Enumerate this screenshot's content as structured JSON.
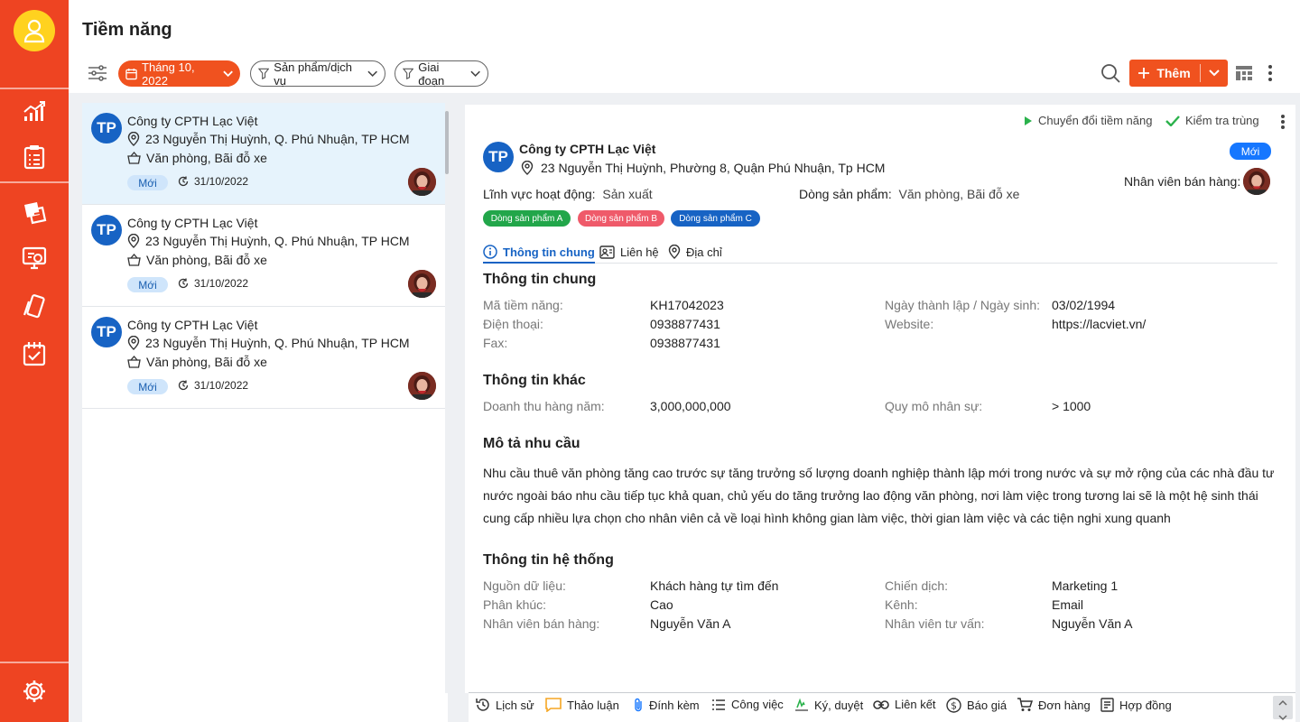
{
  "app": {
    "title": "Tiềm năng"
  },
  "colors": {
    "brand": "#ee4422",
    "accent": "#f0521f",
    "primary_blue": "#1763c4",
    "status_blue": "#1677ff"
  },
  "sidebar": {
    "logo_icon": "user-icon",
    "items": [
      {
        "icon": "chart-icon"
      },
      {
        "icon": "clipboard-icon"
      },
      {
        "icon": "ticket-icon"
      },
      {
        "icon": "monitor-icon"
      },
      {
        "icon": "cards-icon"
      },
      {
        "icon": "task-board-icon"
      }
    ],
    "settings_icon": "gear-icon"
  },
  "toolbar": {
    "filter_icon": "sliders-icon",
    "date_filter": "Tháng 10, 2022",
    "product_filter": "Sản phẩm/dịch vụ",
    "stage_filter": "Giai đoạn",
    "add_label": "Thêm"
  },
  "list": {
    "items": [
      {
        "initials": "TP",
        "name": "Công ty CPTH Lạc Việt",
        "address": "23 Nguyễn Thị Huỳnh, Q. Phú Nhuận, TP HCM",
        "products": "Văn phòng, Bãi đỗ xe",
        "status": "Mới",
        "date": "31/10/2022",
        "active": true
      },
      {
        "initials": "TP",
        "name": "Công ty CPTH Lạc Việt",
        "address": "23 Nguyễn Thị Huỳnh, Q. Phú Nhuận, TP HCM",
        "products": "Văn phòng, Bãi đỗ xe",
        "status": "Mới",
        "date": "31/10/2022",
        "active": false
      },
      {
        "initials": "TP",
        "name": "Công ty CPTH Lạc Việt",
        "address": "23 Nguyễn Thị Huỳnh, Q. Phú Nhuận, TP HCM",
        "products": "Văn phòng, Bãi đỗ xe",
        "status": "Mới",
        "date": "31/10/2022",
        "active": false
      }
    ]
  },
  "detail": {
    "actions": {
      "convert": "Chuyển đổi tiềm năng",
      "check": "Kiểm tra trùng"
    },
    "initials": "TP",
    "name": "Công ty CPTH Lạc Việt",
    "address": "23 Nguyễn Thị Huỳnh, Phường 8, Quận Phú Nhuận, Tp HCM",
    "status": "Mới",
    "sales_label": "Nhân viên bán hàng:",
    "field_label": "Lĩnh vực hoạt động:",
    "field_value": "Sản xuất",
    "product_line_label": "Dòng sản phẩm:",
    "product_line_value": "Văn phòng, Bãi đỗ xe",
    "tags": [
      {
        "label": "Dòng sản phẩm A",
        "color": "#22a64a"
      },
      {
        "label": "Dòng sản phẩm B",
        "color": "#ef5a6a"
      },
      {
        "label": "Dòng sản phẩm C",
        "color": "#1763c4"
      }
    ],
    "tabs": [
      "Thông tin chung",
      "Liên hệ",
      "Địa chỉ"
    ],
    "general": {
      "title": "Thông tin chung",
      "code_label": "Mã tiềm năng:",
      "code": "KH17042023",
      "phone_label": "Điện thoại:",
      "phone": "0938877431",
      "fax_label": "Fax:",
      "fax": "0938877431",
      "founded_label": "Ngày thành lập / Ngày sinh:",
      "founded": "03/02/1994",
      "website_label": "Website:",
      "website": "https://lacviet.vn/"
    },
    "other": {
      "title": "Thông tin khác",
      "revenue_label": "Doanh thu hàng năm:",
      "revenue": "3,000,000,000",
      "scale_label": "Quy mô nhân sự:",
      "scale": "> 1000"
    },
    "needs": {
      "title": "Mô tả nhu cầu",
      "text": "Nhu cầu thuê văn phòng tăng cao trước sự tăng trưởng số lượng doanh nghiệp thành lập mới trong nước và sự mở rộng của các nhà đầu tư nước ngoài báo nhu cầu tiếp tục khả quan, chủ yếu do tăng trưởng lao động văn phòng, nơi làm việc trong tương lai sẽ là một hệ sinh thái cung cấp nhiều lựa chọn cho nhân viên cả về loại hình không gian làm việc, thời gian làm việc và các tiện nghi xung quanh"
    },
    "system": {
      "title": "Thông tin hệ thống",
      "source_label": "Nguồn dữ liệu:",
      "source": "Khách hàng tự tìm đến",
      "segment_label": "Phân khúc:",
      "segment": "Cao",
      "sales_label": "Nhân viên bán hàng:",
      "sales": "Nguyễn Văn A",
      "campaign_label": "Chiến dịch:",
      "campaign": "Marketing 1",
      "channel_label": "Kênh:",
      "channel": "Email",
      "consultant_label": "Nhân viên tư vấn:",
      "consultant": "Nguyễn Văn A"
    }
  },
  "bottom": {
    "items": [
      "Lịch sử",
      "Thảo luận",
      "Đính kèm",
      "Công việc",
      "Ký, duyệt",
      "Liên kết",
      "Báo giá",
      "Đơn hàng",
      "Hợp đồng"
    ]
  }
}
